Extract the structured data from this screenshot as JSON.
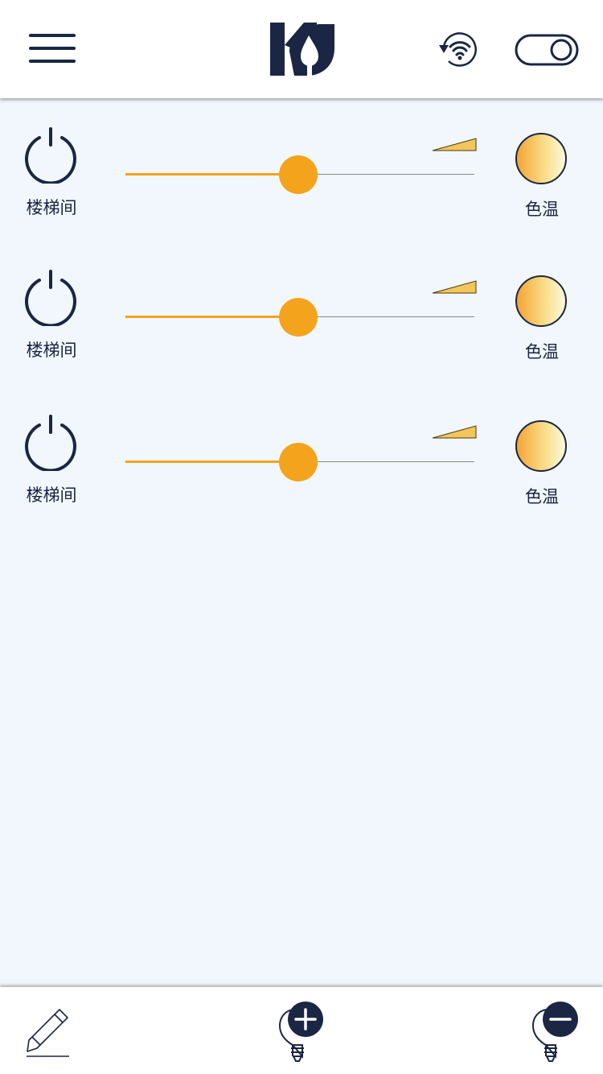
{
  "header": {
    "menu_icon": "hamburger-menu-icon",
    "logo_icon": "brand-logo-icon",
    "wifi_icon": "wifi-refresh-icon",
    "toggle_icon": "toggle-switch-icon"
  },
  "colors": {
    "accent": "#f4a31c",
    "navy": "#1a2644",
    "background": "#f1f7fc",
    "track": "#8a8a8a"
  },
  "rows": [
    {
      "label": "楼梯间",
      "brightness": 0.495,
      "temp_label": "色温"
    },
    {
      "label": "楼梯间",
      "brightness": 0.495,
      "temp_label": "色温"
    },
    {
      "label": "楼梯间",
      "brightness": 0.495,
      "temp_label": "色温"
    }
  ],
  "footer": {
    "edit_icon": "pencil-icon",
    "add_icon": "add-bulb-icon",
    "remove_icon": "remove-bulb-icon"
  }
}
